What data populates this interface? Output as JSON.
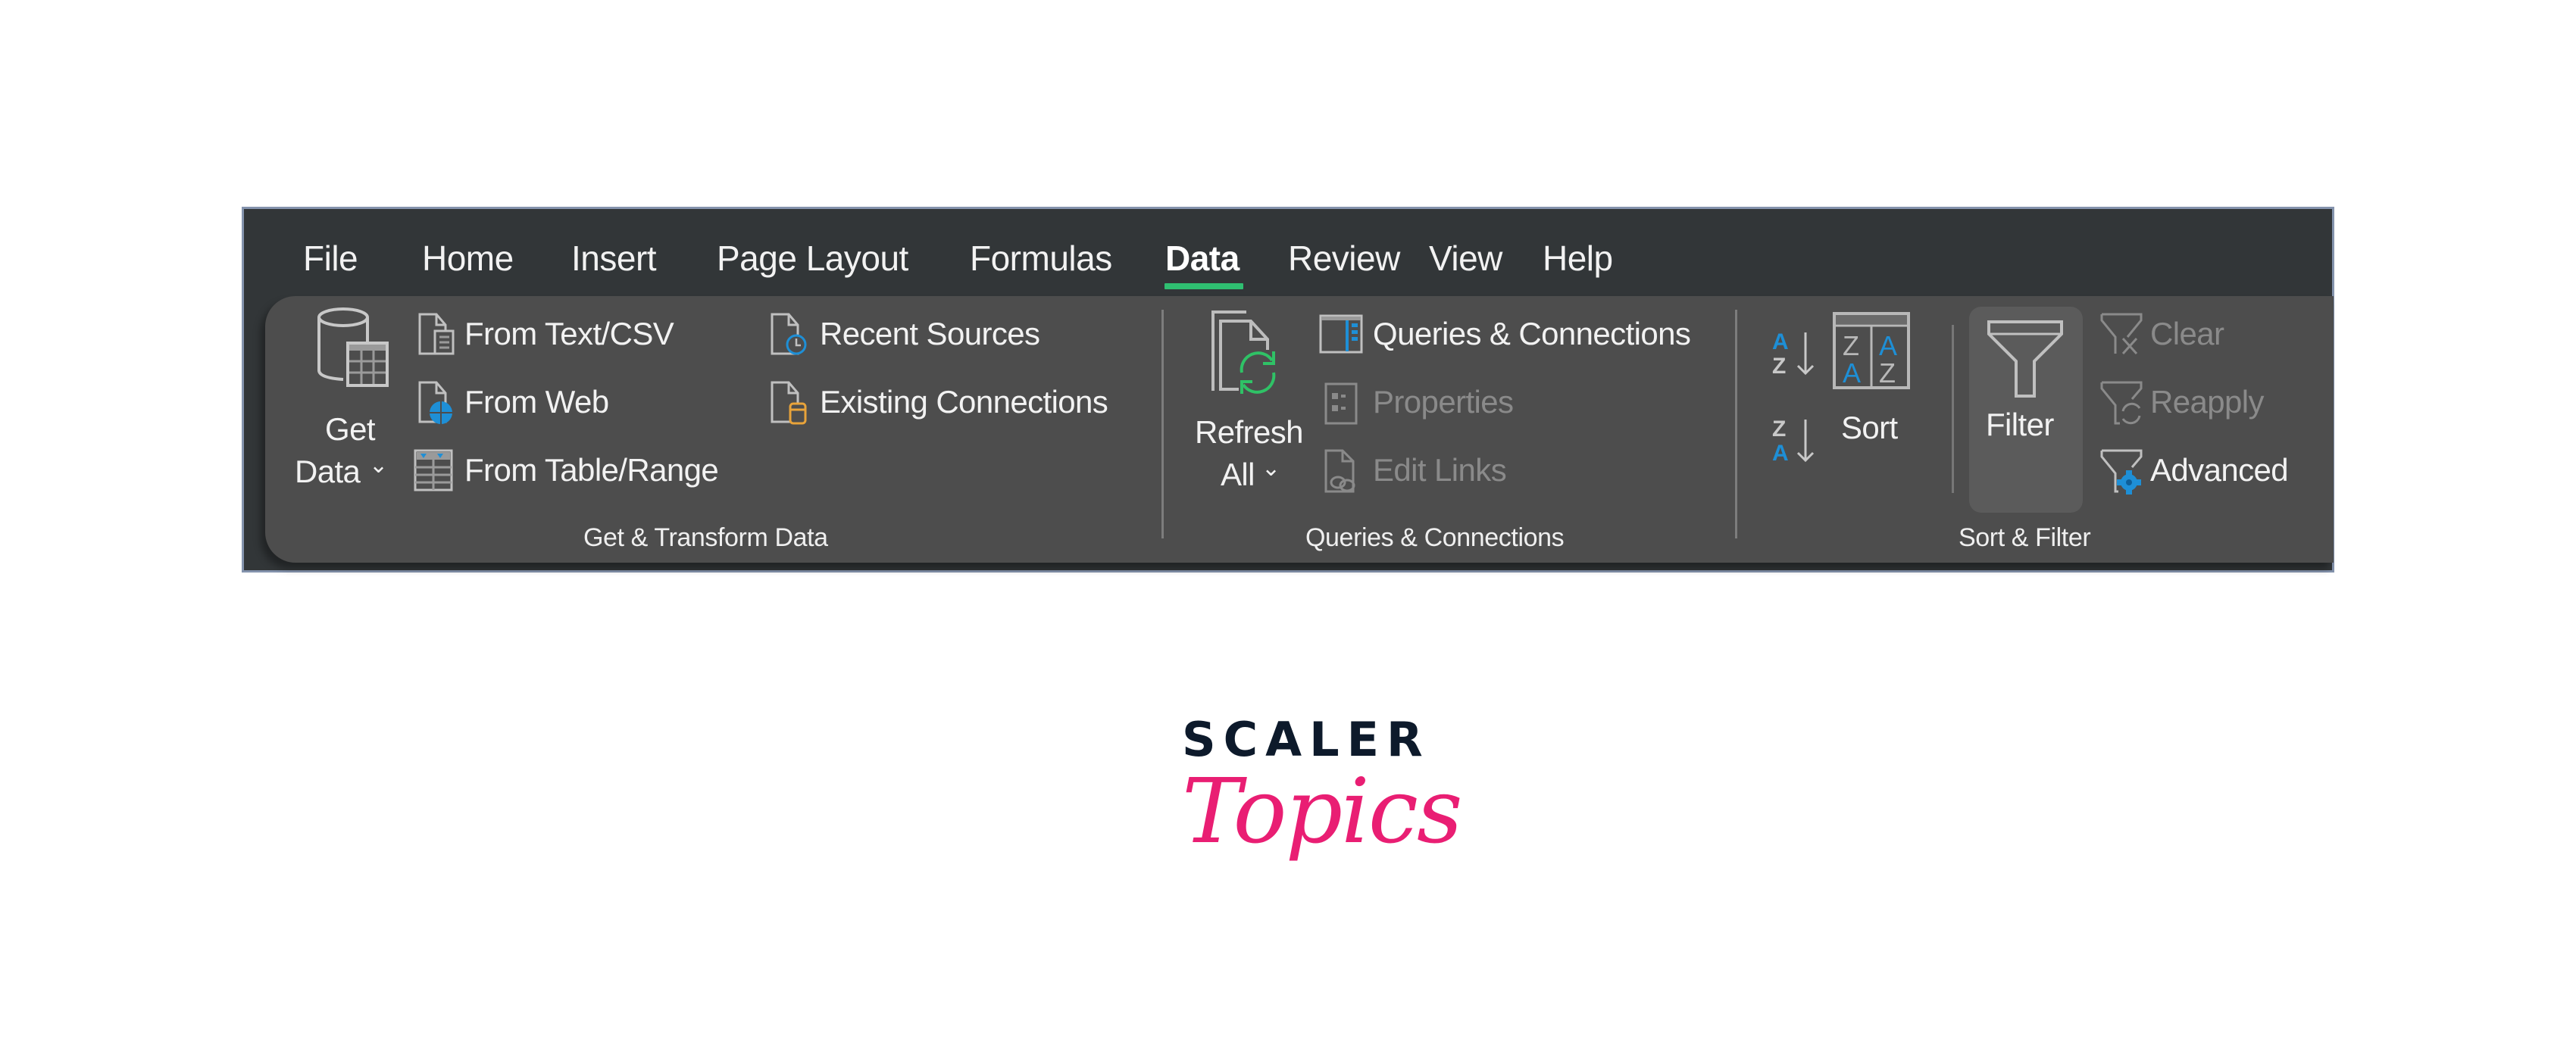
{
  "ribbon": {
    "tabs": [
      {
        "label": "File"
      },
      {
        "label": "Home"
      },
      {
        "label": "Insert"
      },
      {
        "label": "Page Layout"
      },
      {
        "label": "Formulas"
      },
      {
        "label": "Data",
        "active": true
      },
      {
        "label": "Review"
      },
      {
        "label": "View"
      },
      {
        "label": "Help"
      }
    ],
    "active_tab_color": "#2fbf71",
    "groups": {
      "get_transform": {
        "label": "Get & Transform Data",
        "get_data": {
          "line1": "Get",
          "line2": "Data",
          "icon": "database-table-icon"
        },
        "items": [
          {
            "label": "From Text/CSV",
            "icon": "text-file-icon",
            "enabled": true
          },
          {
            "label": "From Web",
            "icon": "web-globe-icon",
            "enabled": true
          },
          {
            "label": "From Table/Range",
            "icon": "table-range-icon",
            "enabled": true
          },
          {
            "label": "Recent Sources",
            "icon": "recent-clock-icon",
            "enabled": true
          },
          {
            "label": "Existing Connections",
            "icon": "existing-connections-icon",
            "enabled": true
          }
        ]
      },
      "queries": {
        "label": "Queries & Connections",
        "refresh": {
          "line1": "Refresh",
          "line2": "All",
          "icon": "refresh-icon"
        },
        "items": [
          {
            "label": "Queries & Connections",
            "icon": "queries-pane-icon",
            "enabled": true
          },
          {
            "label": "Properties",
            "icon": "properties-icon",
            "enabled": false
          },
          {
            "label": "Edit Links",
            "icon": "edit-links-icon",
            "enabled": false
          }
        ]
      },
      "sort_filter": {
        "label": "Sort & Filter",
        "sort_az": {
          "top": "A",
          "bottom": "Z"
        },
        "sort_za": {
          "top": "Z",
          "bottom": "A"
        },
        "sort": {
          "label": "Sort",
          "icon_letters": [
            "Z",
            "A",
            "A",
            "Z"
          ]
        },
        "filter": {
          "label": "Filter",
          "pressed": true
        },
        "items": [
          {
            "label": "Clear",
            "icon": "clear-filter-icon",
            "enabled": false
          },
          {
            "label": "Reapply",
            "icon": "reapply-filter-icon",
            "enabled": false
          },
          {
            "label": "Advanced",
            "icon": "advanced-filter-icon",
            "enabled": true
          }
        ]
      }
    },
    "colors": {
      "accent_blue": "#1e8fd6",
      "refresh_green": "#2fc266",
      "connection_orange": "#e8a33a"
    }
  },
  "logo": {
    "top": "SCALER",
    "bottom": "Topics"
  }
}
